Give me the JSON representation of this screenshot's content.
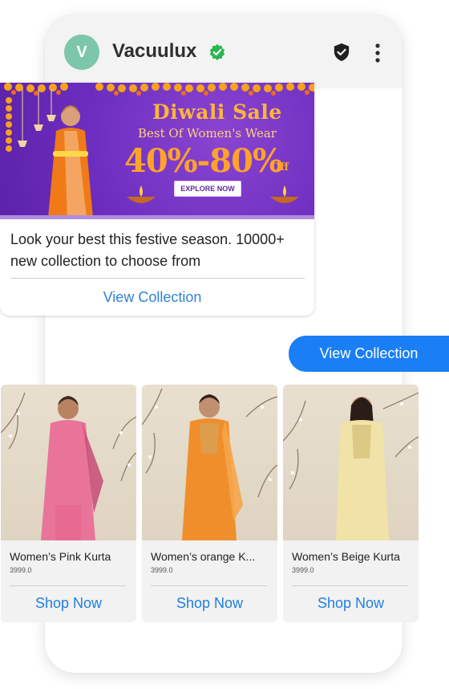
{
  "header": {
    "avatar_letter": "V",
    "title": "Vacuulux",
    "icons": [
      "verified-check-icon",
      "shield-check-icon",
      "more-vert-icon"
    ],
    "accent_color": "#7cc7a9"
  },
  "banner": {
    "sale_title": "Diwali Sale",
    "sale_subtitle": "Best Of Women's Wear",
    "offer": "40%-80%",
    "offer_suffix": "Off",
    "explore_label": "EXPLORE NOW",
    "message": "Look your best this festive season. 10000+ new collection to choose from",
    "action_label": "View Collection"
  },
  "chip": {
    "label": "View Collection",
    "color": "#1a7ff4"
  },
  "products": [
    {
      "name": "Women’s Pink Kurta",
      "price": "3999.0",
      "cta": "Shop Now",
      "kurta_color": "#e9749a"
    },
    {
      "name": "Women’s orange K...",
      "price": "3999.0",
      "cta": "Shop Now",
      "kurta_color": "#f08e2c"
    },
    {
      "name": "Women’s Beige Kurta",
      "price": "3999.0",
      "cta": "Shop Now",
      "kurta_color": "#f1e3a8"
    }
  ]
}
